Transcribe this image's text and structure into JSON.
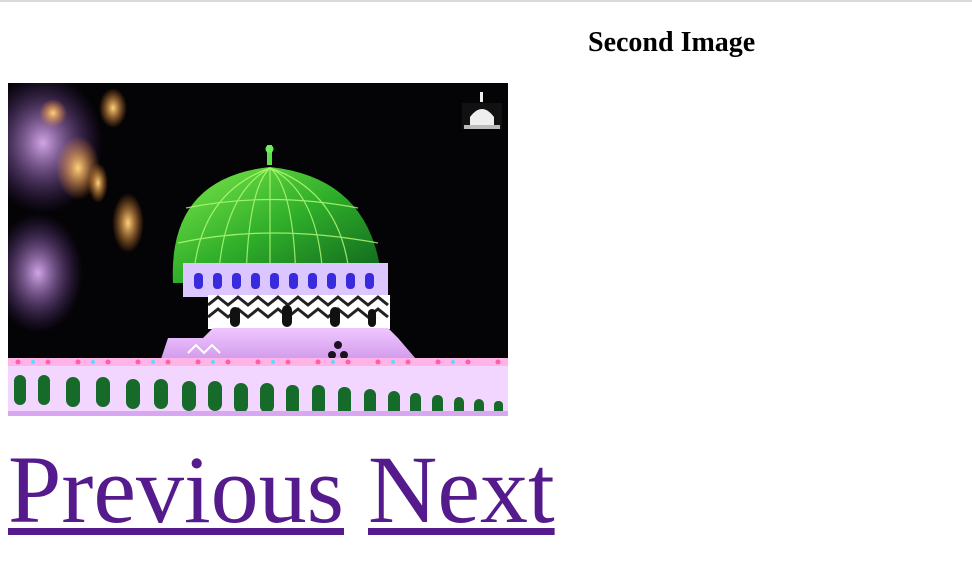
{
  "slide": {
    "heading": "Second Image",
    "image_alt": "Illuminated green dome shrine at night"
  },
  "nav": {
    "previous_label": "Previous",
    "next_label": "Next"
  },
  "colors": {
    "link_visited": "#551a8b",
    "dome_green": "#2fae2a",
    "lights_purple": "#c98cf0"
  }
}
